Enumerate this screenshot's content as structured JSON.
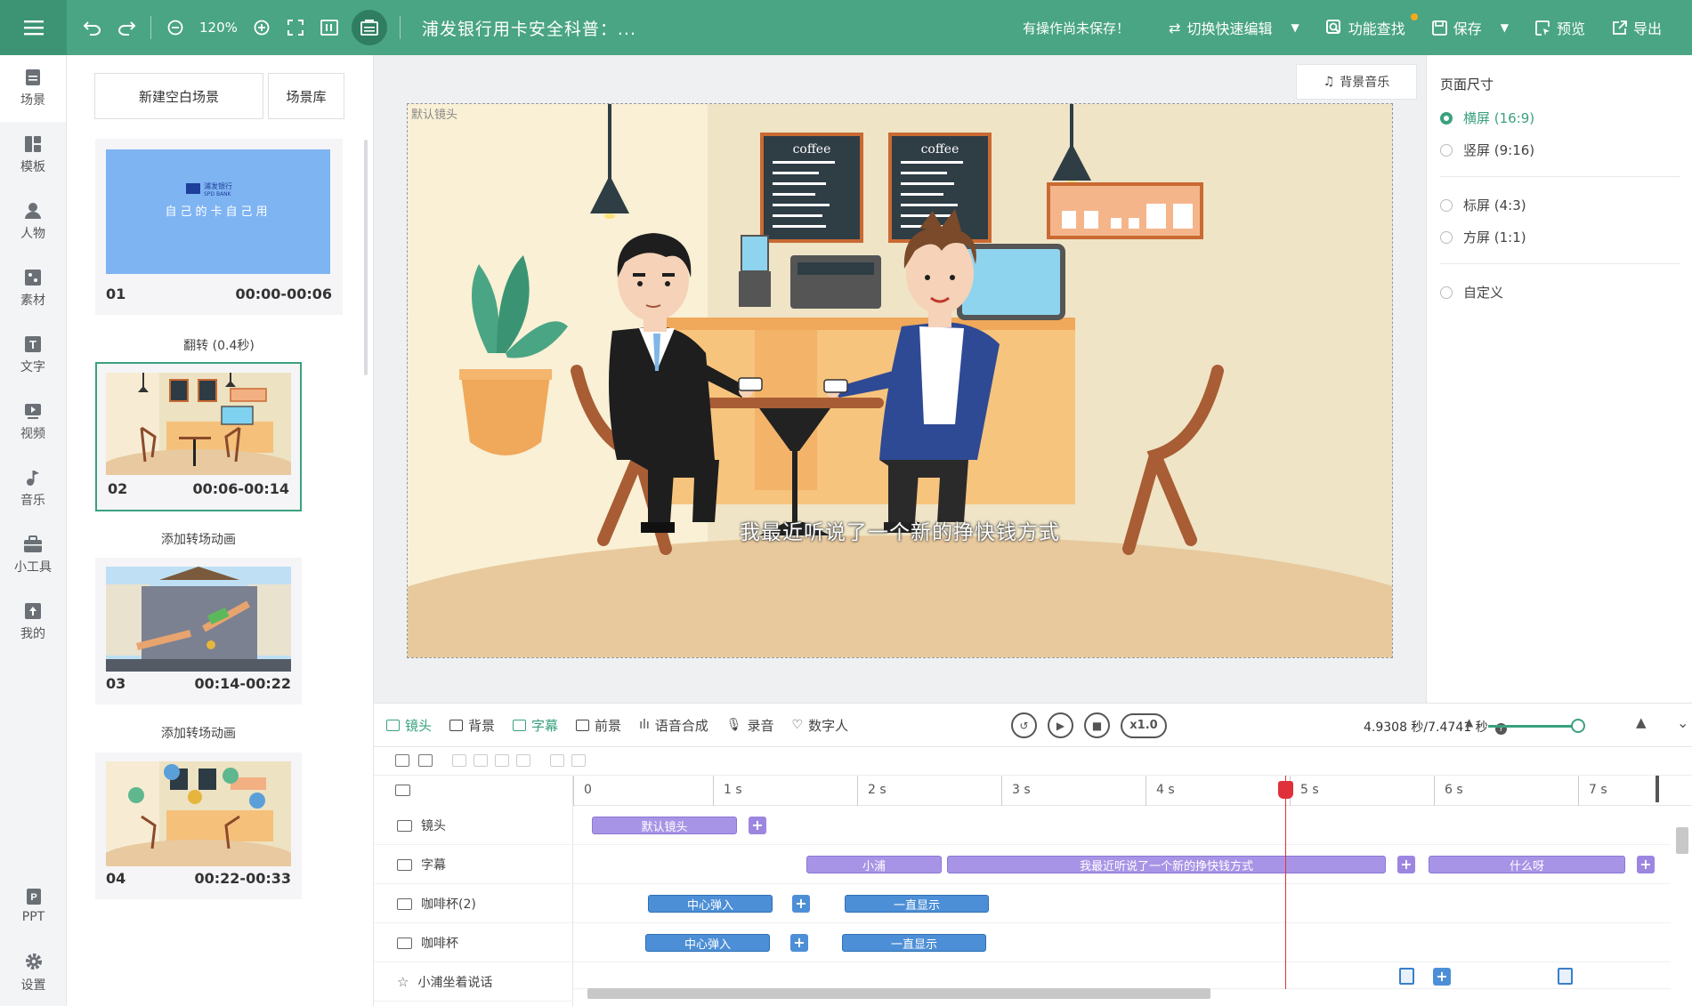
{
  "topbar": {
    "zoom": "120%",
    "title": "浦发银行用卡安全科普：...",
    "unsaved": "有操作尚未保存！",
    "switch_edit": "切换快速编辑",
    "find": "功能查找",
    "save": "保存",
    "preview": "预览",
    "export": "导出"
  },
  "nav": {
    "items": [
      "场景",
      "模板",
      "人物",
      "素材",
      "文字",
      "视频",
      "音乐",
      "小工具",
      "我的"
    ],
    "bottom": [
      "PPT",
      "设置"
    ]
  },
  "scene_panel": {
    "new_blank": "新建空白场景",
    "library": "场景库",
    "scenes": [
      {
        "num": "01",
        "time": "00:00-00:06",
        "thumb_text": "自己的卡自己用",
        "bank_name": "浦发银行",
        "bank_en": "SPD BANK"
      },
      {
        "num": "02",
        "time": "00:06-00:14"
      },
      {
        "num": "03",
        "time": "00:14-00:22"
      },
      {
        "num": "04",
        "time": "00:22-00:33"
      }
    ],
    "transitions": [
      "翻转 (0.4秒)",
      "添加转场动画",
      "添加转场动画"
    ]
  },
  "canvas": {
    "bgm": "背景音乐",
    "lens_label": "默认镜头",
    "subtitle": "我最近听说了一个新的挣快钱方式",
    "menu_board_1": "coffee",
    "menu_board_2": "coffee"
  },
  "page_size": {
    "title": "页面尺寸",
    "options": [
      {
        "label": "横屏 (16:9)",
        "checked": true
      },
      {
        "label": "竖屏 (9:16)",
        "checked": false
      },
      {
        "label": "标屏 (4:3)",
        "checked": false
      },
      {
        "label": "方屏 (1:1)",
        "checked": false
      },
      {
        "label": "自定义",
        "checked": false
      }
    ]
  },
  "bottom_toolbar": {
    "tabs": [
      "镜头",
      "背景",
      "字幕",
      "前景",
      "语音合成",
      "录音",
      "数字人"
    ],
    "active_tab": "字幕",
    "speed": "x1.0",
    "time": "4.9308 秒/7.4741 秒"
  },
  "timeline": {
    "ticks": [
      "0",
      "1 s",
      "2 s",
      "3 s",
      "4 s",
      "5 s",
      "6 s",
      "7 s"
    ],
    "rows": [
      {
        "label": "镜头",
        "clips": [
          "默认镜头"
        ]
      },
      {
        "label": "字幕",
        "clips": [
          "小浦",
          "我最近听说了一个新的挣快钱方式",
          "什么呀"
        ]
      },
      {
        "label": "咖啡杯(2)",
        "clips": [
          "中心弹入",
          "一直显示"
        ]
      },
      {
        "label": "咖啡杯",
        "clips": [
          "中心弹入",
          "一直显示"
        ]
      },
      {
        "label": "小浦坐着说话",
        "clips": []
      }
    ]
  },
  "colors": {
    "brand": "#4aa584",
    "accent": "#3aa17e",
    "clip_purple": "#a894e6",
    "clip_blue": "#4d8fd6",
    "playhead": "#e0303a"
  }
}
